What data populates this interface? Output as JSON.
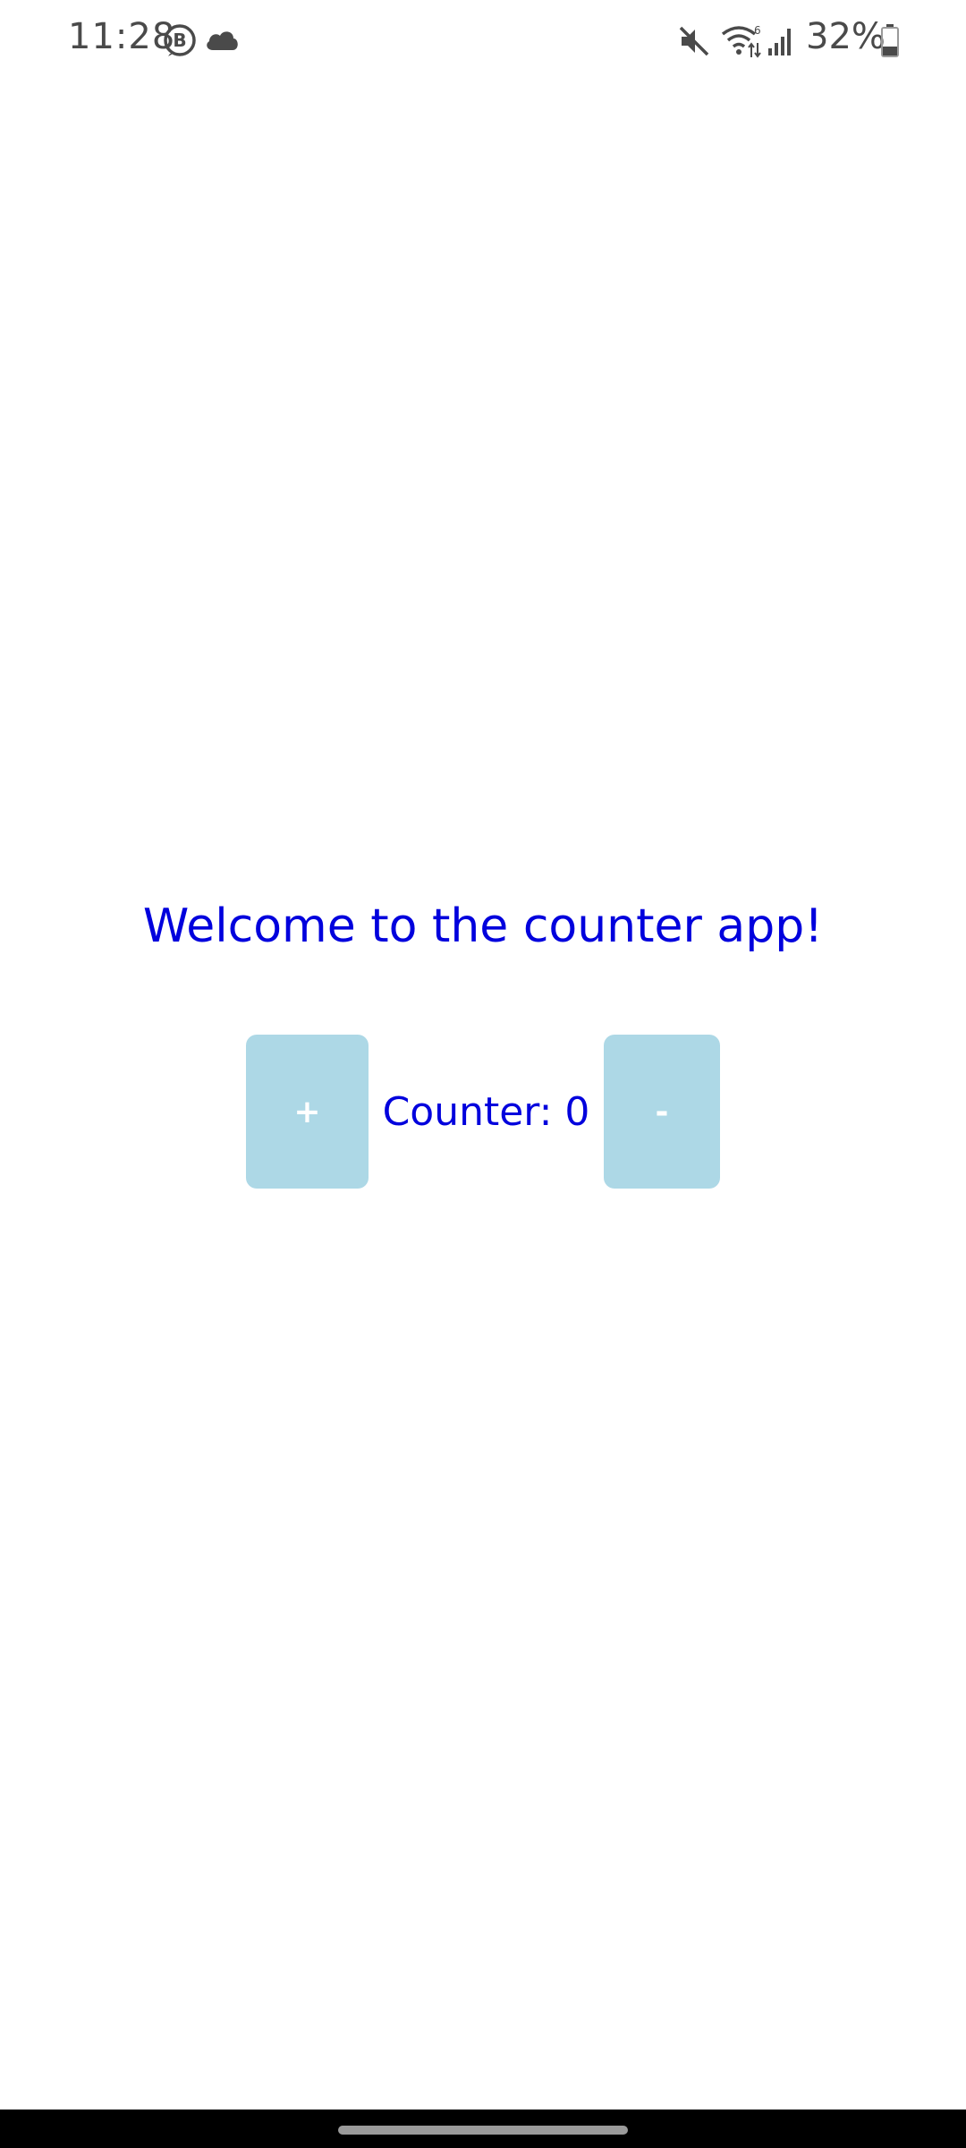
{
  "status_bar": {
    "time": "11:28",
    "battery_percent": "32%",
    "icons": [
      "b-badge-icon",
      "cloud-icon",
      "mute-icon",
      "wifi-icon",
      "signal-icon",
      "battery-icon"
    ],
    "battery_level": 0.32
  },
  "main": {
    "welcome_text": "Welcome to the counter app!",
    "increment_label": "+",
    "decrement_label": "-",
    "counter_text": "Counter: 0"
  },
  "colors": {
    "text_accent": "#0000dd",
    "button_bg": "#add8e6",
    "button_text": "#ffffff",
    "nav_bar": "#000000"
  }
}
